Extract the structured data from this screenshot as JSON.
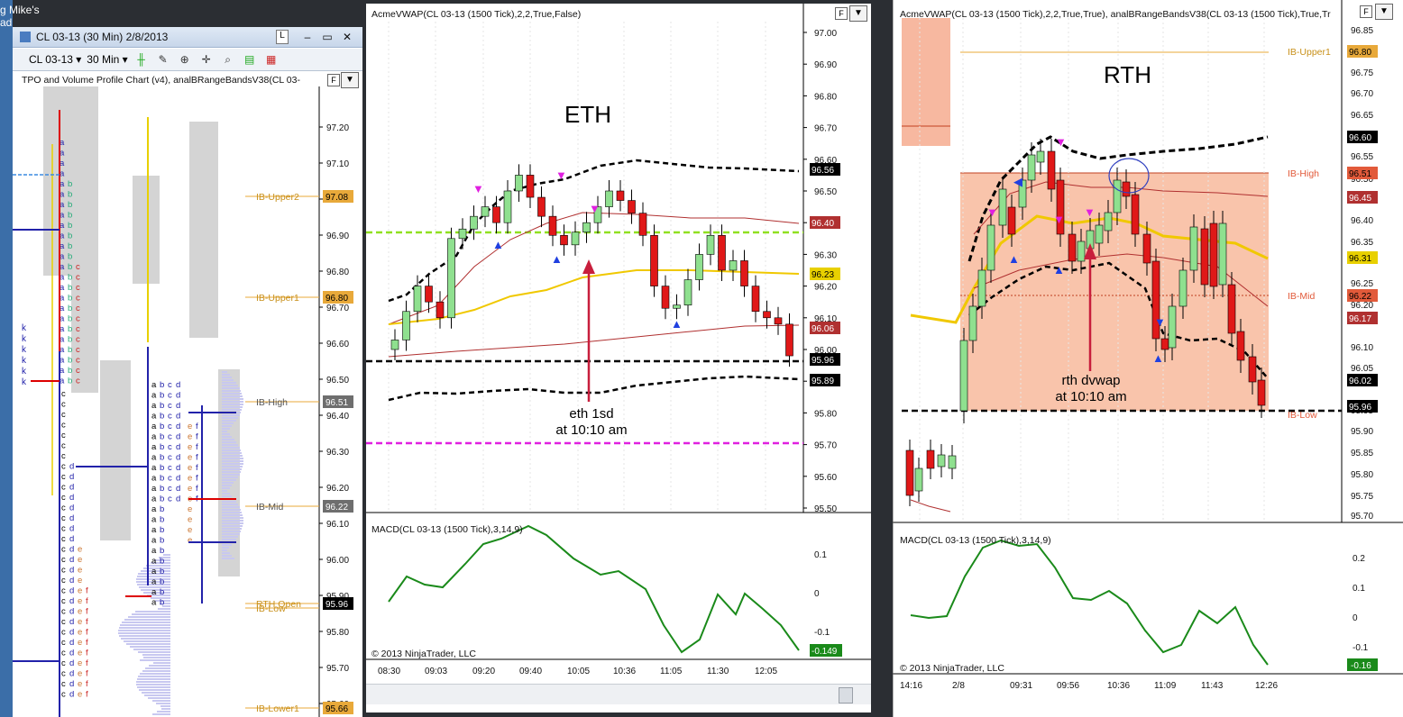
{
  "desktop": {
    "left_fragment": "g Mike's",
    "left_fragment2": "ad"
  },
  "left_window": {
    "title": "CL 03-13 (30 Min)  2/8/2013",
    "toolbar": {
      "instrument": "CL 03-13",
      "interval": "30 Min"
    },
    "indicator_label": "TPO and Volume Profile Chart (v4), analBRangeBandsV38(CL 03-",
    "f_button": "F",
    "axis_ticks": [
      "97.20",
      "97.10",
      "97.00",
      "96.90",
      "96.80",
      "96.70",
      "96.60",
      "96.50",
      "96.40",
      "96.30",
      "96.20",
      "96.10",
      "96.00",
      "95.90",
      "95.80",
      "95.70",
      "95.60"
    ],
    "levels": [
      {
        "label": "IB-Upper2",
        "tag": "97.08",
        "tag_color": "#e8a93a"
      },
      {
        "label": "IB-Upper1",
        "tag": "96.80",
        "tag_color": "#e8a93a"
      },
      {
        "label": "IB-High",
        "tag": "96.51",
        "tag_color": "#6e6e6e"
      },
      {
        "label": "IB-Mid",
        "tag": "96.22",
        "tag_color": "#6e6e6e"
      },
      {
        "label": "RTH Open",
        "tag": "95.96",
        "tag_color": "#000000"
      },
      {
        "label": "IB-Low",
        "tag": "",
        "tag_color": ""
      },
      {
        "label": "IB-Lower1",
        "tag": "95.66",
        "tag_color": "#e8a93a"
      }
    ],
    "tpo_letters": {
      "k": "k",
      "b": "b",
      "c": "c",
      "d": "d",
      "e": "e",
      "f": "f",
      "a": "a"
    }
  },
  "mid_window": {
    "indicator_label": "AcmeVWAP(CL 03-13 (1500 Tick),2,2,True,False)",
    "f_button": "F",
    "annotation_title": "ETH",
    "annotation_arrow_text1": "eth 1sd",
    "annotation_arrow_text2": "at 10:10 am",
    "axis_ticks": [
      "97.00",
      "96.90",
      "96.80",
      "96.70",
      "96.60",
      "96.50",
      "96.40",
      "96.30",
      "96.20",
      "96.10",
      "96.00",
      "95.90",
      "95.80",
      "95.70",
      "95.60",
      "95.50"
    ],
    "price_tags": [
      {
        "value": "96.56",
        "color": "#000000"
      },
      {
        "value": "96.40",
        "color": "#b03030"
      },
      {
        "value": "96.23",
        "color": "#e8d000"
      },
      {
        "value": "96.06",
        "color": "#b03030"
      },
      {
        "value": "95.96",
        "color": "#000000"
      },
      {
        "value": "95.89",
        "color": "#000000"
      }
    ],
    "macd_label": "MACD(CL 03-13 (1500 Tick),3,14,9)",
    "macd_ticks": [
      "0.1",
      "0",
      "-0.1"
    ],
    "macd_tag": "-0.149",
    "copyright": "© 2013 NinjaTrader, LLC",
    "time_ticks": [
      "08:30",
      "09:03",
      "09:20",
      "09:40",
      "10:05",
      "10:36",
      "11:05",
      "11:30",
      "12:05"
    ]
  },
  "right_window": {
    "indicator_label": "AcmeVWAP(CL 03-13 (1500 Tick),2,2,True,True), analBRangeBandsV38(CL 03-13 (1500 Tick),True,Tr",
    "f_button": "F",
    "annotation_title": "RTH",
    "annotation_arrow_text1": "rth dvwap",
    "annotation_arrow_text2": "at 10:10 am",
    "axis_ticks": [
      "96.85",
      "96.75",
      "96.70",
      "96.65",
      "96.55",
      "96.50",
      "96.40",
      "96.35",
      "96.25",
      "96.20",
      "96.10",
      "96.05",
      "95.95",
      "95.90",
      "95.85",
      "95.80",
      "95.75",
      "95.70"
    ],
    "levels": [
      {
        "label": "IB-Upper1",
        "tag": "96.80",
        "tag_color": "#e8a93a"
      },
      {
        "label": "IB-High",
        "tag": "96.51",
        "tag_color": "#e25a3a"
      },
      {
        "label": "IB-Mid",
        "tag": "96.22",
        "tag_color": "#e25a3a"
      },
      {
        "label": "IB-Low",
        "tag": "",
        "tag_color": ""
      }
    ],
    "price_tags": [
      {
        "value": "96.60",
        "color": "#000000"
      },
      {
        "value": "96.45",
        "color": "#b03030"
      },
      {
        "value": "96.31",
        "color": "#e8d000"
      },
      {
        "value": "96.17",
        "color": "#b03030"
      },
      {
        "value": "96.02",
        "color": "#000000"
      },
      {
        "value": "95.96",
        "color": "#000000"
      }
    ],
    "macd_label": "MACD(CL 03-13 (1500 Tick),3,14,9)",
    "macd_ticks": [
      "0.2",
      "0.1",
      "0",
      "-0.1"
    ],
    "macd_tag": "-0.16",
    "copyright": "© 2013 NinjaTrader, LLC",
    "time_ticks": [
      "14:16",
      "2/8",
      "09:31",
      "09:56",
      "10:36",
      "11:09",
      "11:43",
      "12:26"
    ]
  },
  "chart_data": [
    {
      "type": "candlestick",
      "title": "ETH",
      "ylim": [
        95.5,
        97.05
      ],
      "candles_close": [
        96.03,
        96.12,
        96.2,
        96.15,
        96.1,
        96.35,
        96.38,
        96.42,
        96.45,
        96.4,
        96.5,
        96.55,
        96.48,
        96.42,
        96.36,
        96.33,
        96.37,
        96.4,
        96.45,
        96.5,
        96.47,
        96.43,
        96.36,
        96.2,
        96.13,
        96.14,
        96.22,
        96.3,
        96.36,
        96.25,
        96.28,
        96.2,
        96.12,
        96.1,
        96.08,
        95.98
      ],
      "series": [
        {
          "name": "VWAP",
          "color": "#f0c800"
        },
        {
          "name": "Upper band",
          "color": "#000000"
        },
        {
          "name": "Lower band",
          "color": "#000000"
        }
      ]
    },
    {
      "type": "candlestick",
      "title": "RTH",
      "ylim": [
        95.68,
        96.88
      ]
    }
  ]
}
